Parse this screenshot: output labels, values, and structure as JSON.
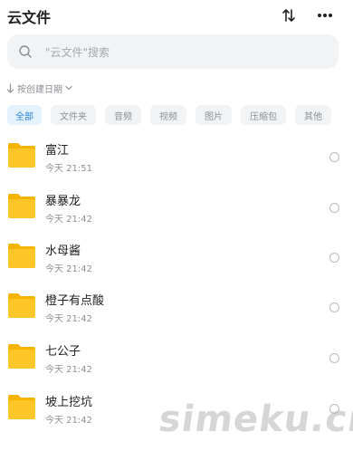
{
  "header": {
    "title": "云文件",
    "sort_icon": "sort-arrows-icon",
    "more_icon": "more-dots-icon"
  },
  "search": {
    "placeholder": "\"云文件\"搜索",
    "icon": "search-icon"
  },
  "sort": {
    "label": "按创建日期",
    "icon": "arrow-down-icon",
    "chevron": "chevron-down-icon"
  },
  "tabs": [
    {
      "label": "全部",
      "active": true
    },
    {
      "label": "文件夹",
      "active": false
    },
    {
      "label": "音频",
      "active": false
    },
    {
      "label": "视频",
      "active": false
    },
    {
      "label": "图片",
      "active": false
    },
    {
      "label": "压缩包",
      "active": false
    },
    {
      "label": "其他",
      "active": false
    }
  ],
  "files": [
    {
      "name": "富江",
      "time": "今天 21:51"
    },
    {
      "name": "暴暴龙",
      "time": "今天 21:42"
    },
    {
      "name": "水母酱",
      "time": "今天 21:42"
    },
    {
      "name": "橙子有点酸",
      "time": "今天 21:42"
    },
    {
      "name": "七公子",
      "time": "今天 21:42"
    },
    {
      "name": "坡上挖坑",
      "time": "今天 21:42"
    }
  ],
  "watermark": "simeku.cn",
  "colors": {
    "folder": "#ffc629",
    "folder_tab": "#f5b400",
    "active_tab_bg": "#e3f2fd",
    "active_tab_text": "#2f80d8",
    "muted_text": "#8d9095"
  }
}
